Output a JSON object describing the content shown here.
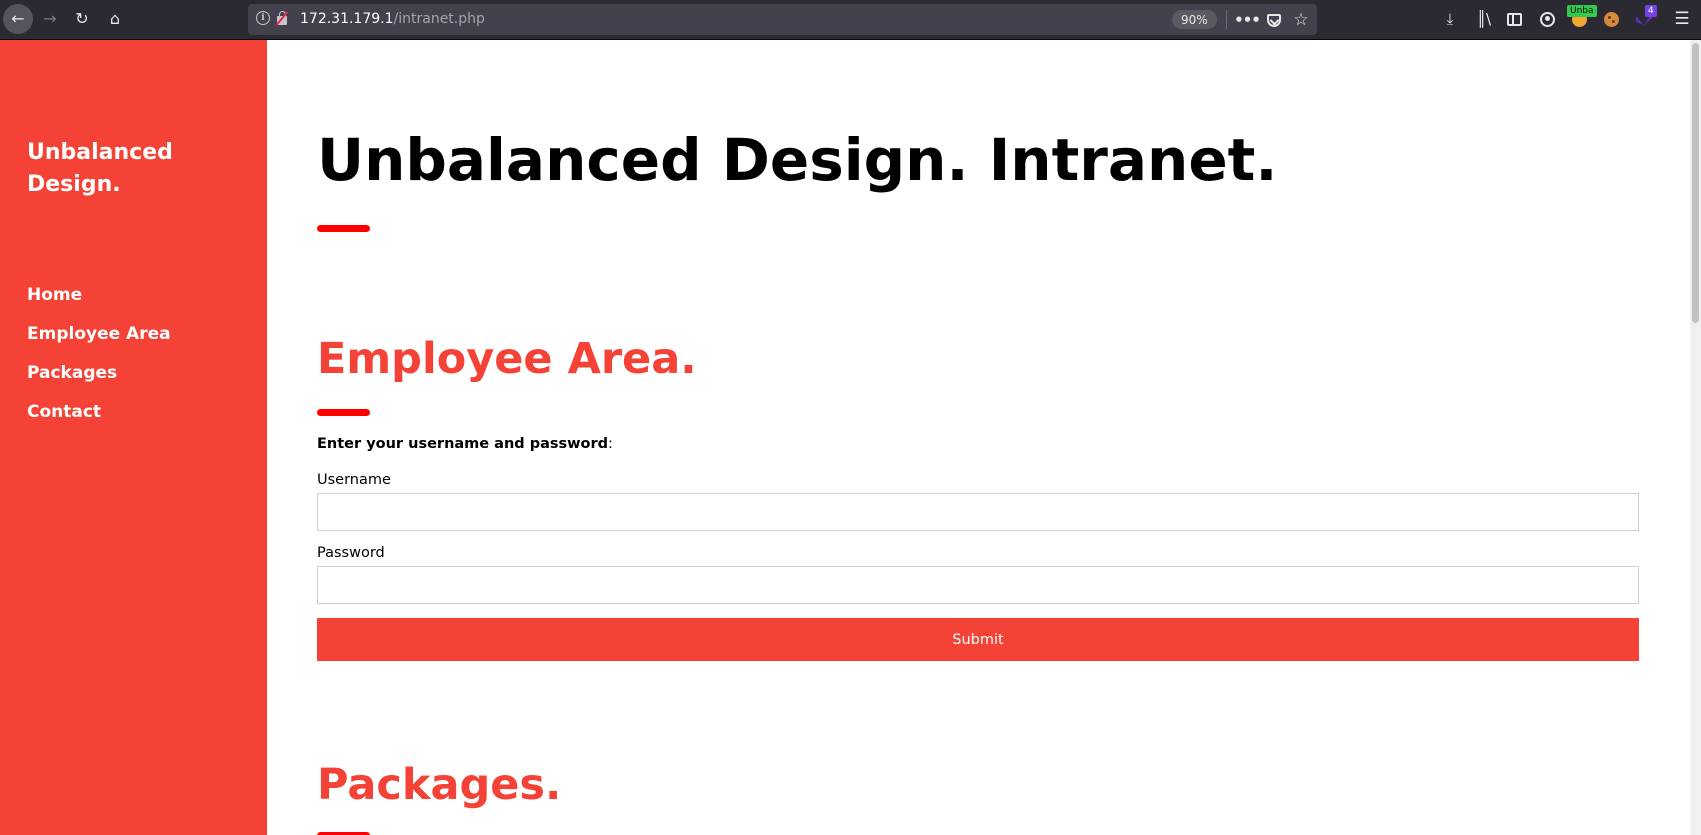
{
  "browser": {
    "url_host": "172.31.179.1",
    "url_path": "/intranet.php",
    "zoom": "90%",
    "extension_badge": "Unba",
    "extension_count": "4",
    "icons": {
      "back": "back-arrow-icon",
      "forward": "forward-arrow-icon",
      "reload": "reload-icon",
      "home": "home-icon",
      "info": "info-icon",
      "insecure": "insecure-lock-icon",
      "more": "more-actions-icon",
      "pocket": "pocket-icon",
      "bookmark": "star-icon",
      "download": "download-icon",
      "library": "library-icon",
      "sidebar": "sidebar-icon",
      "account": "account-icon",
      "menu": "hamburger-menu-icon"
    }
  },
  "sidebar": {
    "brand": "Unbalanced Design.",
    "nav": [
      {
        "label": "Home"
      },
      {
        "label": "Employee Area"
      },
      {
        "label": "Packages"
      },
      {
        "label": "Contact"
      }
    ]
  },
  "main": {
    "title": "Unbalanced Design. Intranet.",
    "employee_section": {
      "title": "Employee Area.",
      "instructions_bold": "Enter your username and password",
      "instructions_suffix": ":",
      "username_label": "Username",
      "username_value": "",
      "password_label": "Password",
      "password_value": "",
      "submit_label": "Submit"
    },
    "packages_section": {
      "title": "Packages."
    }
  },
  "colors": {
    "accent": "#f44336",
    "accent_bar": "#ff0000",
    "chrome": "#2b2a33"
  }
}
